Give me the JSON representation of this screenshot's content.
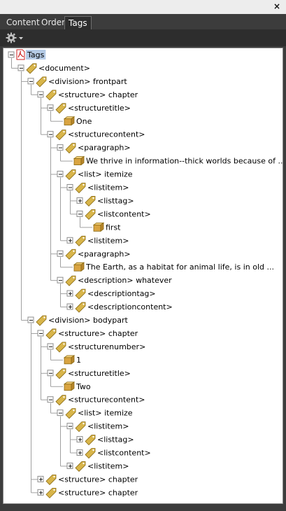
{
  "window": {
    "close_glyph": "×"
  },
  "tabs": [
    {
      "label": "Content",
      "active": false
    },
    {
      "label": "Order",
      "active": false
    },
    {
      "label": "Tags",
      "active": true
    }
  ],
  "toolbar": {
    "options_icon": "gear-icon"
  },
  "colors": {
    "panel_bg": "#3c3c3c",
    "toolbar_bg": "#2d2d2d",
    "selection": "#b5cbe6",
    "tag_icon": "#d8b54a",
    "content_icon": "#d9a441",
    "pdf_icon": "#cc2222"
  },
  "tree": [
    {
      "label": "Tags",
      "depth": 0,
      "kind": "root",
      "toggle": "minus",
      "selected": true
    },
    {
      "label": "<document>",
      "depth": 1,
      "kind": "tag",
      "toggle": "minus"
    },
    {
      "label": "<division> frontpart",
      "depth": 2,
      "kind": "tag",
      "toggle": "minus"
    },
    {
      "label": "<structure> chapter",
      "depth": 3,
      "kind": "tag",
      "toggle": "minus"
    },
    {
      "label": "<structuretitle>",
      "depth": 4,
      "kind": "tag",
      "toggle": "minus"
    },
    {
      "label": "One",
      "depth": 5,
      "kind": "content",
      "toggle": "none"
    },
    {
      "label": "<structurecontent>",
      "depth": 4,
      "kind": "tag",
      "toggle": "minus"
    },
    {
      "label": "<paragraph>",
      "depth": 5,
      "kind": "tag",
      "toggle": "minus"
    },
    {
      "label": "We thrive in information--thick worlds because of ...",
      "depth": 6,
      "kind": "content",
      "toggle": "none"
    },
    {
      "label": "<list> itemize",
      "depth": 5,
      "kind": "tag",
      "toggle": "minus"
    },
    {
      "label": "<listitem>",
      "depth": 6,
      "kind": "tag",
      "toggle": "minus"
    },
    {
      "label": "<listtag>",
      "depth": 7,
      "kind": "tag",
      "toggle": "plus"
    },
    {
      "label": "<listcontent>",
      "depth": 7,
      "kind": "tag",
      "toggle": "minus"
    },
    {
      "label": "first",
      "depth": 8,
      "kind": "content",
      "toggle": "none"
    },
    {
      "label": "<listitem>",
      "depth": 6,
      "kind": "tag",
      "toggle": "plus"
    },
    {
      "label": "<paragraph>",
      "depth": 5,
      "kind": "tag",
      "toggle": "minus"
    },
    {
      "label": "The Earth, as a habitat for animal life, is in old ...",
      "depth": 6,
      "kind": "content",
      "toggle": "none"
    },
    {
      "label": "<description> whatever",
      "depth": 5,
      "kind": "tag",
      "toggle": "minus"
    },
    {
      "label": "<descriptiontag>",
      "depth": 6,
      "kind": "tag",
      "toggle": "plus"
    },
    {
      "label": "<descriptioncontent>",
      "depth": 6,
      "kind": "tag",
      "toggle": "plus"
    },
    {
      "label": "<division> bodypart",
      "depth": 2,
      "kind": "tag",
      "toggle": "minus"
    },
    {
      "label": "<structure> chapter",
      "depth": 3,
      "kind": "tag",
      "toggle": "minus"
    },
    {
      "label": "<structurenumber>",
      "depth": 4,
      "kind": "tag",
      "toggle": "minus"
    },
    {
      "label": "1",
      "depth": 5,
      "kind": "content",
      "toggle": "none"
    },
    {
      "label": "<structuretitle>",
      "depth": 4,
      "kind": "tag",
      "toggle": "minus"
    },
    {
      "label": "Two",
      "depth": 5,
      "kind": "content",
      "toggle": "none"
    },
    {
      "label": "<structurecontent>",
      "depth": 4,
      "kind": "tag",
      "toggle": "minus"
    },
    {
      "label": "<list> itemize",
      "depth": 5,
      "kind": "tag",
      "toggle": "minus"
    },
    {
      "label": "<listitem>",
      "depth": 6,
      "kind": "tag",
      "toggle": "minus"
    },
    {
      "label": "<listtag>",
      "depth": 7,
      "kind": "tag",
      "toggle": "plus"
    },
    {
      "label": "<listcontent>",
      "depth": 7,
      "kind": "tag",
      "toggle": "plus"
    },
    {
      "label": "<listitem>",
      "depth": 6,
      "kind": "tag",
      "toggle": "plus"
    },
    {
      "label": "<structure> chapter",
      "depth": 3,
      "kind": "tag",
      "toggle": "plus"
    },
    {
      "label": "<structure> chapter",
      "depth": 3,
      "kind": "tag",
      "toggle": "plus"
    }
  ]
}
